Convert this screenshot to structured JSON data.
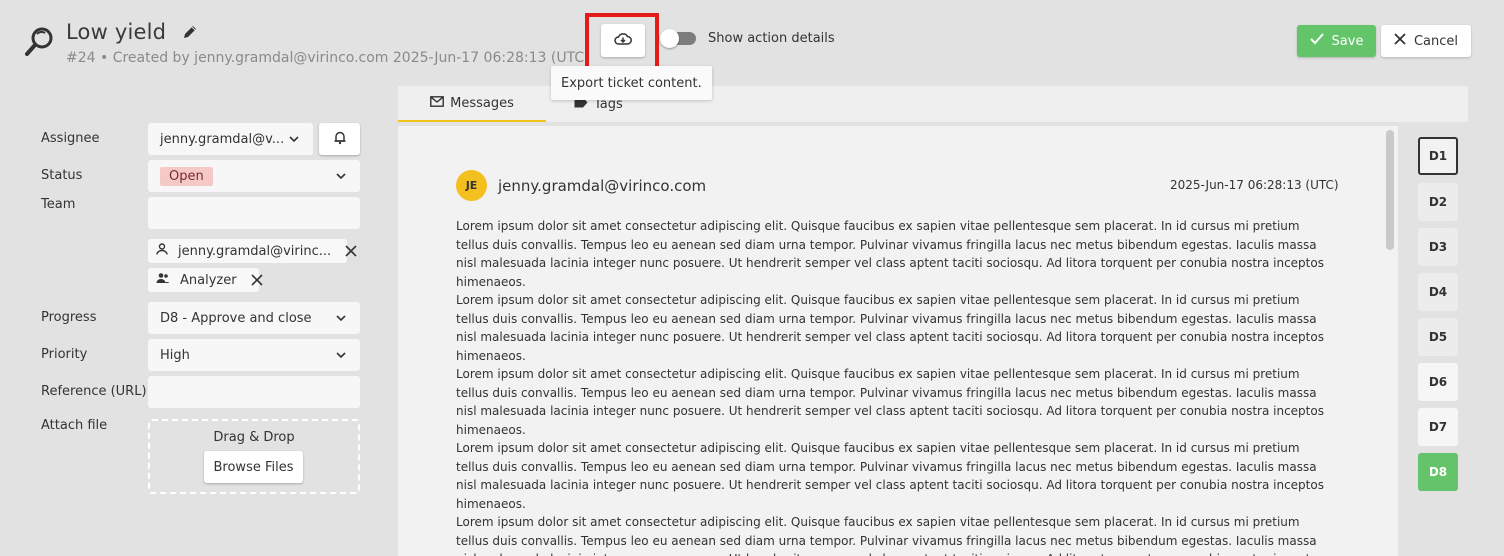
{
  "header": {
    "title": "Low yield",
    "subtitle": "#24 • Created by jenny.gramdal@virinco.com 2025-Jun-17 06:28:13 (UTC)",
    "export_tooltip": "Export ticket content.",
    "toggle_label": "Show action details",
    "toggle_on": false,
    "save_label": "Save",
    "cancel_label": "Cancel"
  },
  "form": {
    "assignee_label": "Assignee",
    "assignee_value": "jenny.gramdal@v...",
    "status_label": "Status",
    "status_value": "Open",
    "team_label": "Team",
    "team_value": "",
    "chips": [
      "jenny.gramdal@virinc...",
      "Analyzer"
    ],
    "progress_label": "Progress",
    "progress_value": "D8 - Approve and close",
    "priority_label": "Priority",
    "priority_value": "High",
    "reference_label": "Reference (URL)",
    "reference_value": "",
    "attach_label": "Attach file",
    "drag_drop": "Drag & Drop",
    "browse_label": "Browse Files"
  },
  "tabs": {
    "messages": "Messages",
    "tags": "Tags"
  },
  "message": {
    "avatar_initials": "JE",
    "sender": "jenny.gramdal@virinco.com",
    "timestamp": "2025-Jun-17 06:28:13 (UTC)",
    "paragraph": "Lorem ipsum dolor sit amet consectetur adipiscing elit. Quisque faucibus ex sapien vitae pellentesque sem placerat. In id cursus mi pretium tellus duis convallis. Tempus leo eu aenean sed diam urna tempor. Pulvinar vivamus fringilla lacus nec metus bibendum egestas. Iaculis massa nisl malesuada lacinia integer nunc posuere. Ut hendrerit semper vel class aptent taciti sociosqu. Ad litora torquent per conubia nostra inceptos himenaeos."
  },
  "steps": [
    "D1",
    "D2",
    "D3",
    "D4",
    "D5",
    "D6",
    "D7",
    "D8"
  ],
  "colors": {
    "accent_green": "#63c46a",
    "highlight_red": "#e21b1b",
    "avatar_yellow": "#f4c020",
    "status_open_bg": "#f6c9c9"
  }
}
